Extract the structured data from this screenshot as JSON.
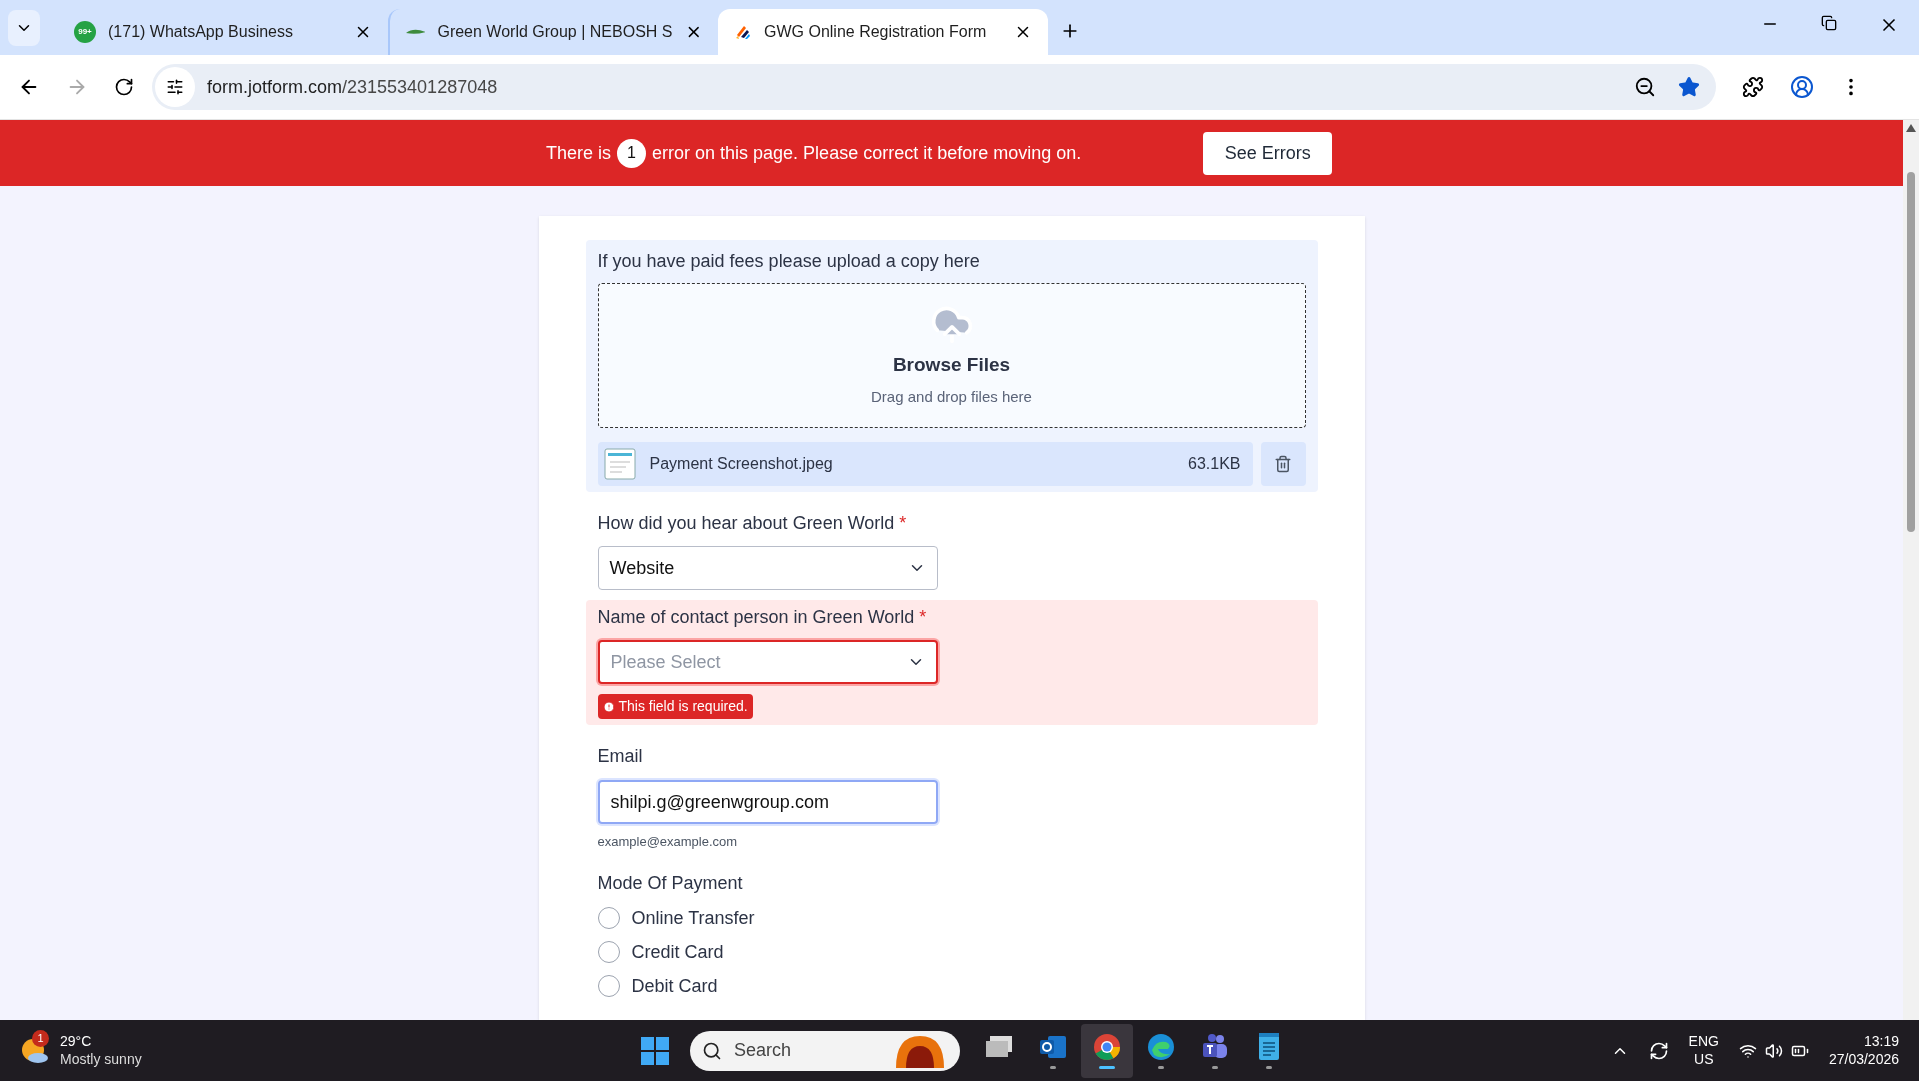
{
  "browser": {
    "tabs": [
      {
        "title": "(171) WhatsApp Business",
        "badge": "99+",
        "kind": "whatsapp",
        "selected": false
      },
      {
        "title": "Green World Group | NEBOSH S",
        "kind": "leaf",
        "selected": false
      },
      {
        "title": "GWG Online Registration Form",
        "kind": "jotform",
        "selected": true
      }
    ],
    "url_host": "form.jotform.com",
    "url_path": "/231553401287048",
    "bookmarked": true
  },
  "error_bar": {
    "before": "There is",
    "count": "1",
    "after": "error on this page. Please correct it before moving on.",
    "button": "See Errors"
  },
  "form": {
    "upload": {
      "label": "If you have paid fees please upload a copy here",
      "title": "Browse Files",
      "hint": "Drag and drop files here",
      "file": {
        "name": "Payment Screenshot.jpeg",
        "size": "63.1KB"
      }
    },
    "fields": [
      {
        "kind": "select",
        "label": "How did you hear about Green World",
        "required_mark": "*",
        "value": "Website",
        "error": false
      },
      {
        "kind": "select",
        "label": "Name of contact person in Green World",
        "required_mark": "*",
        "placeholder": "Please Select",
        "error": true,
        "error_text": "This field is required."
      },
      {
        "kind": "email",
        "label": "Email",
        "value": "shilpi.g@greenwgroup.com",
        "focused": true,
        "sublabel": "example@example.com"
      },
      {
        "kind": "radio",
        "label": "Mode Of Payment",
        "options": [
          {
            "label": "Online Transfer",
            "selected": false
          },
          {
            "label": "Credit Card",
            "selected": false
          },
          {
            "label": "Debit Card",
            "selected": false
          }
        ]
      }
    ]
  },
  "taskbar": {
    "weather": {
      "temp": "29°C",
      "text": "Mostly sunny",
      "badge": "1"
    },
    "search_placeholder": "Search",
    "apps": [
      {
        "kind": "files",
        "active": false,
        "open": false
      },
      {
        "kind": "outlook",
        "active": false,
        "open": true
      },
      {
        "kind": "chrome",
        "active": true,
        "open": true
      },
      {
        "kind": "edge",
        "active": false,
        "open": true
      },
      {
        "kind": "teams",
        "active": false,
        "open": true
      },
      {
        "kind": "notepad",
        "active": false,
        "open": true
      }
    ],
    "lang": "ENG",
    "region": "US",
    "time": "13:19",
    "date": "27/03/2026"
  }
}
